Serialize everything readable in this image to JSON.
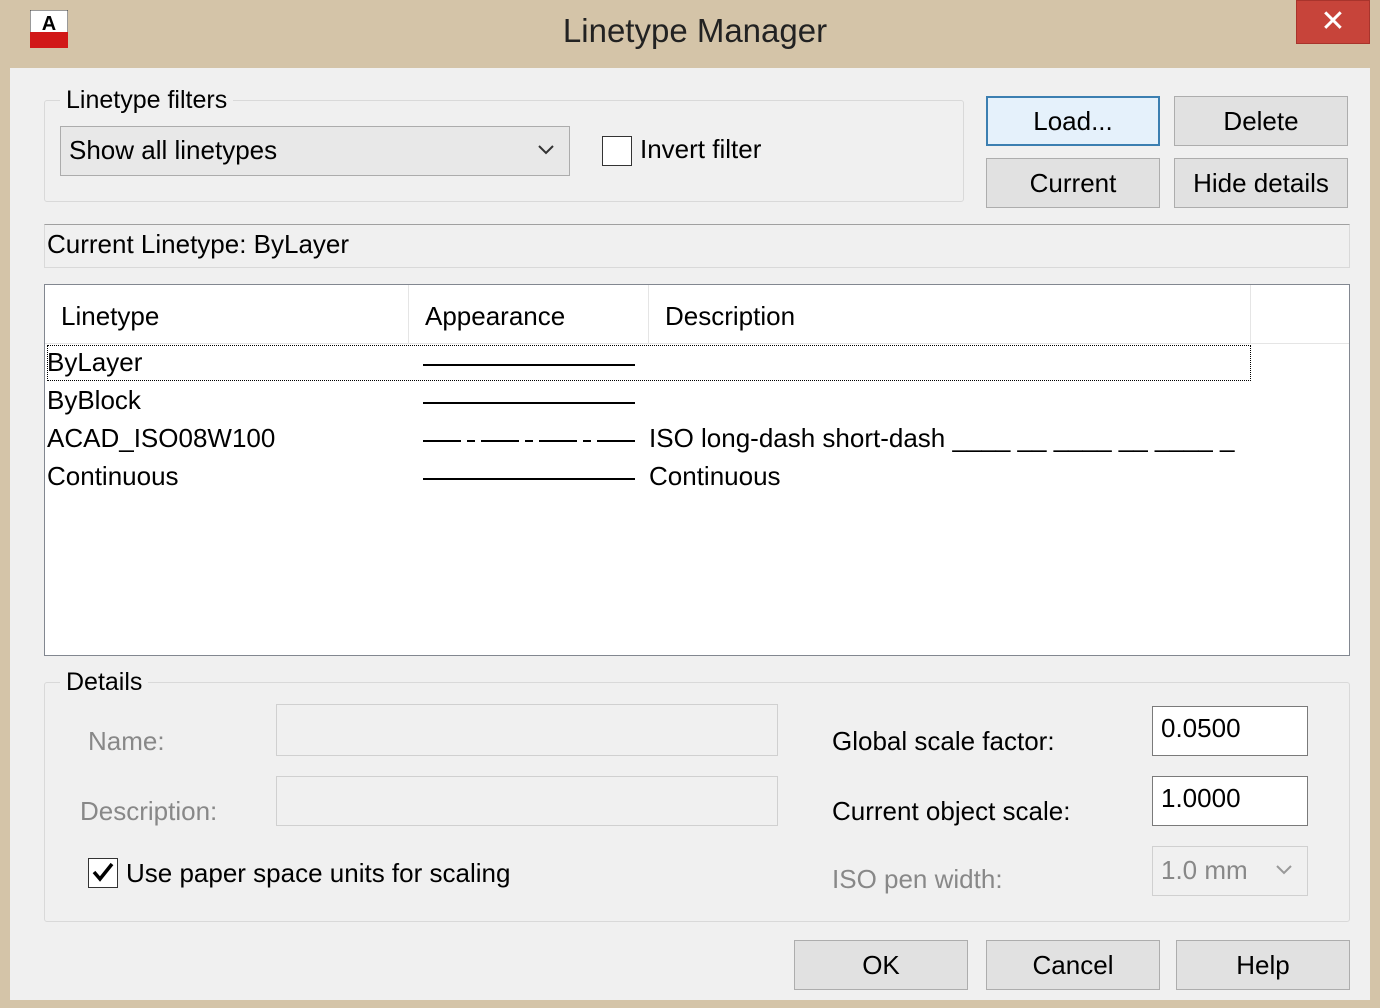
{
  "window": {
    "title": "Linetype Manager",
    "close_glyph": "✕",
    "app_icon": "autocad-icon"
  },
  "filters": {
    "legend": "Linetype filters",
    "selected": "Show all linetypes",
    "invert_label": "Invert filter",
    "invert_checked": false
  },
  "buttons": {
    "load": "Load...",
    "delete": "Delete",
    "current": "Current",
    "hide_details": "Hide details",
    "ok": "OK",
    "cancel": "Cancel",
    "help": "Help"
  },
  "current_linetype": "Current Linetype:  ByLayer",
  "list": {
    "columns": [
      "Linetype",
      "Appearance",
      "Description"
    ],
    "rows": [
      {
        "name": "ByLayer",
        "appearance": "solid",
        "description": ""
      },
      {
        "name": "ByBlock",
        "appearance": "solid",
        "description": ""
      },
      {
        "name": "ACAD_ISO08W100",
        "appearance": "long-dash-short-dash",
        "description": "ISO long-dash short-dash ____ __ ____ __ ____ _"
      },
      {
        "name": "Continuous",
        "appearance": "solid",
        "description": "Continuous"
      }
    ]
  },
  "details": {
    "legend": "Details",
    "name_label": "Name:",
    "name_value": "",
    "description_label": "Description:",
    "description_value": "",
    "paper_space_label": "Use paper space units for scaling",
    "paper_space_checked": true,
    "global_scale_label": "Global scale factor:",
    "global_scale_value": "0.0500",
    "object_scale_label": "Current object scale:",
    "object_scale_value": "1.0000",
    "iso_pen_label": "ISO pen width:",
    "iso_pen_value": "1.0 mm"
  },
  "colors": {
    "title_bar": "#d4c4a8",
    "close_button": "#c7443a",
    "dialog_bg": "#f0f0f0"
  }
}
